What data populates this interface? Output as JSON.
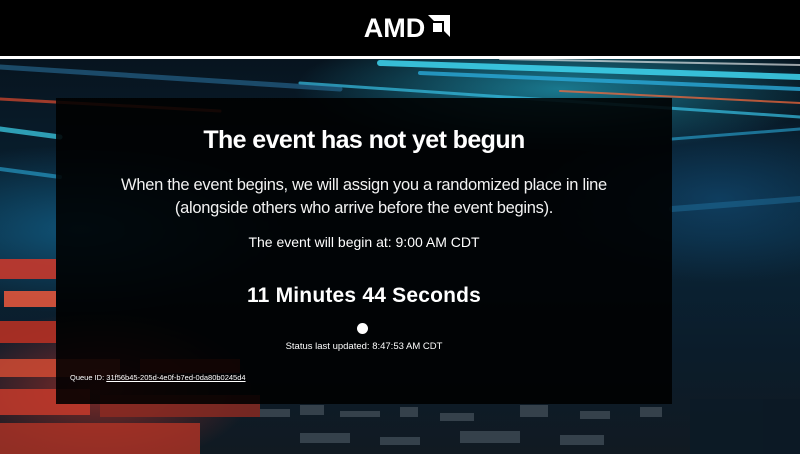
{
  "header": {
    "logo_text": "AMD",
    "logo_icon": "amd-arrow-logo-icon"
  },
  "background": {
    "description_icon": "circuit-light-streaks-background",
    "accent_cyan": "#3cc8e6",
    "accent_red": "#c0392b"
  },
  "panel": {
    "title": "The event has not yet begun",
    "description": "When the event begins, we will assign you a randomized place in line (alongside others who arrive before the event begins).",
    "start_time_label": "The event will begin at: 9:00 AM CDT",
    "countdown": "11 Minutes 44 Seconds",
    "status_updated": "Status last updated: 8:47:53 AM CDT",
    "queue_id_label": "Queue ID:",
    "queue_id_value": "31f56b45-205d-4e0f-b7ed-0da80b0245d4"
  }
}
